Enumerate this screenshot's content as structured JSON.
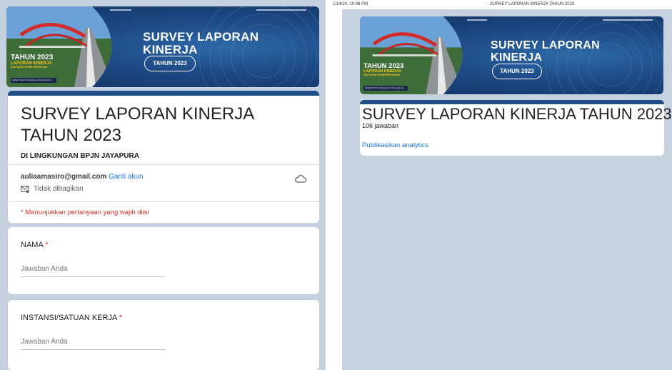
{
  "banner": {
    "title_line1": "SURVEY LAPORAN",
    "title_line2": "KINERJA",
    "pill_label": "TAHUN 2023",
    "year_badge": "TAHUN 2023",
    "year_sub1": "LAPORAN KINERJA",
    "year_sub2": "INSTANSI PEMERINTAHAN",
    "org_strip": "DIREKTORAT JENDERAL BINA MARGA"
  },
  "form": {
    "title": "SURVEY LAPORAN KINERJA TAHUN 2023",
    "description": "DI LINGKUNGAN BPJN JAYAPURA",
    "account_email": "auliaamasiro@gmail.com",
    "switch_account": "Ganti akun",
    "not_shared": "Tidak dibagikan",
    "required_note": "* Menunjukkan pertanyaan yang wajib diisi",
    "questions": [
      {
        "label": "NAMA",
        "required_mark": "*",
        "placeholder": "Jawaban Anda"
      },
      {
        "label": "INSTANSI/SATUAN KERJA",
        "required_mark": "*",
        "placeholder": "Jawaban Anda"
      }
    ]
  },
  "print": {
    "timestamp": "1/14/24, 10:48 PM",
    "header_title": "SURVEY LAPORAN KINERJA TAHUN 2023"
  },
  "responses": {
    "title": "SURVEY LAPORAN KINERJA TAHUN 2023",
    "count_text": "106 jawaban",
    "publish_link": "Publikasikan analytics"
  },
  "colors": {
    "accent": "#1f4f86",
    "page_bg": "#c5d1df",
    "link": "#1a73e8",
    "required": "#d93025"
  }
}
